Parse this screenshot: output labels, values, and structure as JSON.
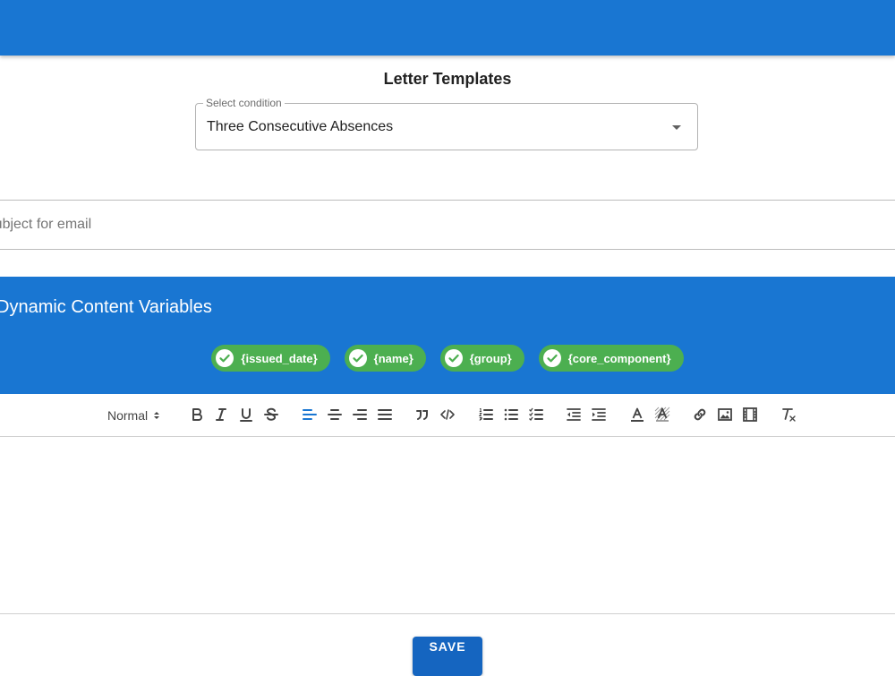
{
  "page": {
    "title": "Letter Templates"
  },
  "condition_select": {
    "label": "Select condition",
    "value": "Three Consecutive Absences"
  },
  "subject": {
    "placeholder": "Subject for email",
    "value": ""
  },
  "variables_panel": {
    "title": "Dynamic Content Variables",
    "chips": [
      {
        "label": "{issued_date}",
        "icon": "check-circle-icon"
      },
      {
        "label": "{name}",
        "icon": "check-circle-icon"
      },
      {
        "label": "{group}",
        "icon": "check-circle-icon"
      },
      {
        "label": "{core_component}",
        "icon": "check-circle-icon"
      }
    ]
  },
  "toolbar": {
    "header_select": "Normal",
    "tools": [
      "bold-icon",
      "italic-icon",
      "underline-icon",
      "strikethrough-icon",
      "align-left-icon",
      "align-center-icon",
      "align-right-icon",
      "align-justify-icon",
      "blockquote-icon",
      "code-block-icon",
      "ordered-list-icon",
      "bullet-list-icon",
      "check-list-icon",
      "outdent-icon",
      "indent-icon",
      "text-color-icon",
      "background-color-icon",
      "link-icon",
      "image-icon",
      "video-icon",
      "clear-format-icon"
    ]
  },
  "actions": {
    "save_label": "SAVE"
  },
  "colors": {
    "primary": "#1976d2",
    "chip": "#4caf50",
    "save_button": "#1565c0",
    "active_tool": "#1976d2",
    "tool": "#444444"
  }
}
